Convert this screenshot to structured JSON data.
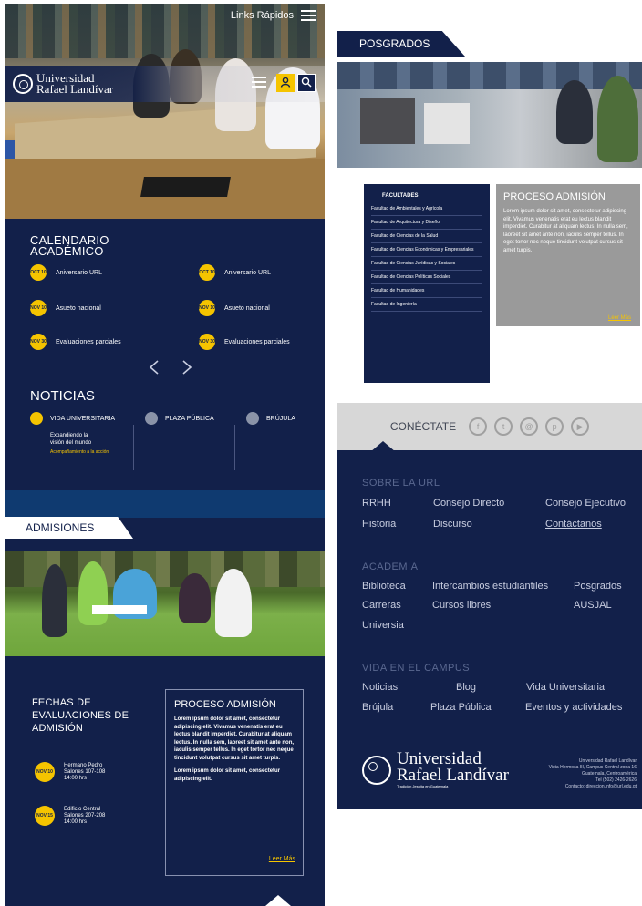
{
  "header": {
    "quick_links": "Links Rápidos",
    "logo_line1": "Universidad",
    "logo_line2": "Rafael Landívar"
  },
  "calendario": {
    "title_line1": "CALENDARIO",
    "title_line2": "ACADÉMICO",
    "items": [
      {
        "badge": "OCT 10",
        "label": "Aniversario URL"
      },
      {
        "badge": "OCT 10",
        "label": "Aniversario URL"
      },
      {
        "badge": "NOV 10",
        "label": "Asueto nacional"
      },
      {
        "badge": "NOV 10",
        "label": "Asueto nacional"
      },
      {
        "badge": "NOV 30",
        "label": "Evaluaciones parciales"
      },
      {
        "badge": "NOV 30",
        "label": "Evaluaciones parciales"
      }
    ]
  },
  "noticias": {
    "title": "NOTICIAS",
    "tabs": [
      "VIDA UNIVERSITARIA",
      "PLAZA PÚBLICA",
      "BRÚJULA"
    ],
    "story_line1": "Expandiendo la",
    "story_line2": "visión del mundo",
    "story_link": "Acompañamiento a la acción"
  },
  "admisiones": {
    "tab": "ADMISIONES",
    "fechas_title_line1": "FECHAS DE",
    "fechas_title_line2": "EVALUACIONES DE",
    "fechas_title_line3": "ADMISIÓN",
    "fechas": [
      {
        "badge": "NOV 10",
        "line1": "Hermano Pedro",
        "line2": "Salones 107-108",
        "line3": "14:00 hrs"
      },
      {
        "badge": "NOV 15",
        "line1": "Edificio Central",
        "line2": "Salones 207-208",
        "line3": "14:00 hrs"
      }
    ],
    "proceso_title": "PROCESO ADMISIÓN",
    "proceso_p1": "Lorem ipsum dolor sit amet, consectetur adipiscing elit. Vivamus venenatis erat eu lectus blandit imperdiet. Curabitur at aliquam lectus. In nulla sem, laoreet sit amet ante non, iaculis semper tellus. In eget tortor nec neque tincidunt volutpat cursus sit amet turpis.",
    "proceso_p2": "Lorem ipsum dolor sit amet, consectetur adipiscing elit.",
    "leer_mas": "Leer Más"
  },
  "posgrados": {
    "tab": "POSGRADOS",
    "facultades_title": "FACULTADES",
    "facultades": [
      "Facultad de Ambientales y Agrícola",
      "Facultad de Arquitectura y Diseño",
      "Facultad de Ciencias de la Salud",
      "Facultad de Ciencias Económicas y Empresariales",
      "Facultad de Ciencias Jurídicas y Sociales",
      "Facultad de Ciencias Políticas Sociales",
      "Facultad de Humanidades",
      "Facultad de Ingeniería"
    ],
    "proceso_title": "PROCESO ADMISIÓN",
    "proceso_text": "Lorem ipsum dolor sit amet, consectetur adipiscing elit. Vivamus venenatis erat eu lectus blandit imperdiet. Curabitur at aliquam lectus. In nulla sem, laoreet sit amet ante non, iaculis semper tellus. In eget tortor nec neque tincidunt volutpat cursus sit amet turpis.",
    "leer_mas": "Leer Más"
  },
  "connect": {
    "label": "CONÉCTATE",
    "icons": [
      "f",
      "t",
      "@",
      "p",
      "▶"
    ]
  },
  "footer": {
    "sobre_title": "SOBRE LA URL",
    "sobre_links": [
      "RRHH",
      "Consejo Directo",
      "Consejo Ejecutivo",
      "Historia",
      "Discurso",
      "Contáctanos"
    ],
    "academia_title": "ACADEMIA",
    "academia_links": [
      "Biblioteca",
      "Intercambios estudiantiles",
      "Posgrados",
      "Carreras",
      "Cursos libres",
      "AUSJAL",
      "Universia"
    ],
    "vida_title": "VIDA EN EL CAMPUS",
    "vida_links": [
      "Noticias",
      "Blog",
      "Vida Universitaria",
      "Brújula",
      "Plaza Pública",
      "Eventos y actividades"
    ],
    "logo_line1": "Universidad",
    "logo_line2": "Rafael Landívar",
    "logo_tagline": "Tradición Jesuita en Guatemala",
    "address": [
      "Universidad Rafael Landívar",
      "Vista Hermosa III, Campus Central zona 16",
      "Guatemala, Centroamérica",
      "Tel (502) 2426-2626",
      "Contacto: direccion.info@url.edu.gt"
    ]
  }
}
